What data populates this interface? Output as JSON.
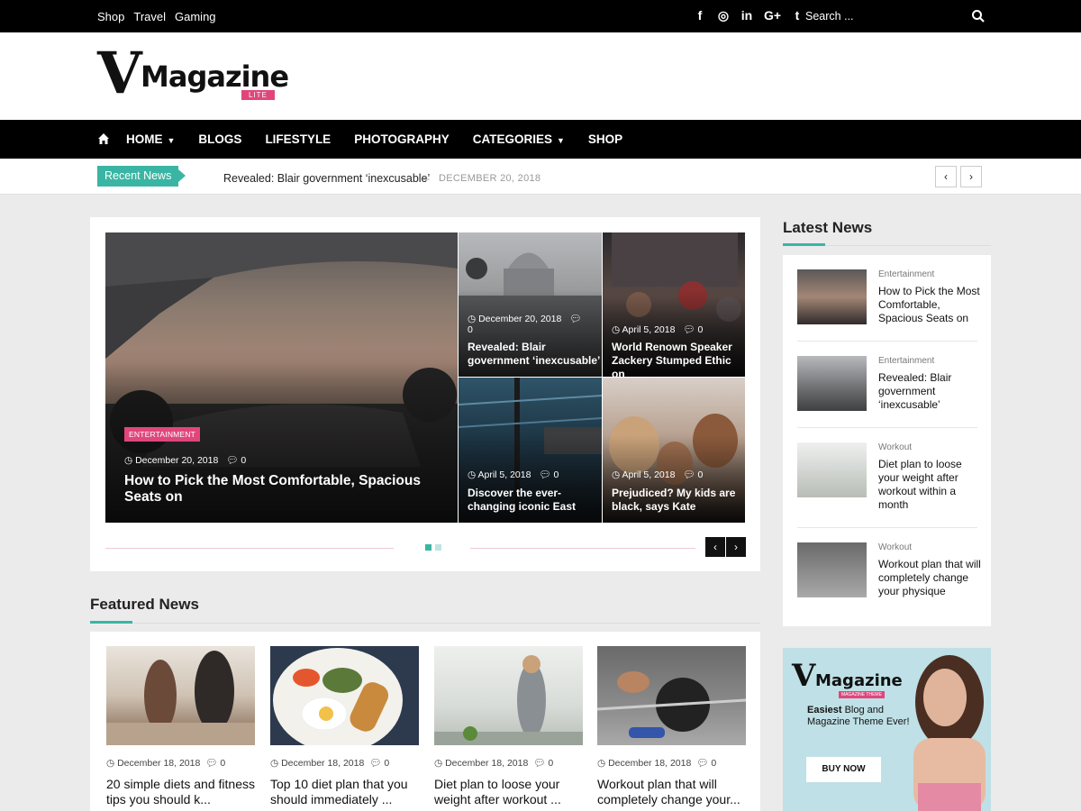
{
  "topbar": {
    "links": [
      "Shop",
      "Travel",
      "Gaming"
    ],
    "social_icons": [
      "facebook-icon",
      "instagram-icon",
      "linkedin-icon",
      "google-plus-icon",
      "tumblr-icon"
    ],
    "social_glyphs": [
      "f",
      "◎",
      "in",
      "G+",
      "t"
    ],
    "search_placeholder": "Search ..."
  },
  "logo": {
    "v": "V",
    "text": "Magazine",
    "badge": "LITE"
  },
  "nav": {
    "items": [
      {
        "label": "HOME",
        "dropdown": true
      },
      {
        "label": "BLOGS",
        "dropdown": false
      },
      {
        "label": "LIFESTYLE",
        "dropdown": false
      },
      {
        "label": "PHOTOGRAPHY",
        "dropdown": false
      },
      {
        "label": "CATEGORIES",
        "dropdown": true
      },
      {
        "label": "SHOP",
        "dropdown": false
      }
    ]
  },
  "ticker": {
    "label": "Recent News",
    "title": "Revealed: Blair government ‘inexcusable’",
    "dash": "–",
    "date": "DECEMBER 20, 2018",
    "prev": "‹",
    "next": "›"
  },
  "slider": {
    "main": {
      "category": "ENTERTAINMENT",
      "date": "December 20, 2018",
      "comments": "0",
      "title": "How to Pick the Most Comfortable, Spacious Seats on"
    },
    "tiles": [
      {
        "date": "December 20, 2018",
        "comments": "0",
        "title": "Revealed: Blair government ‘inexcusable’"
      },
      {
        "date": "April 5, 2018",
        "comments": "0",
        "title": "World Renown Speaker Zackery Stumped Ethic on"
      },
      {
        "date": "April 5, 2018",
        "comments": "0",
        "title": "Discover the ever-changing iconic East"
      },
      {
        "date": "April 5, 2018",
        "comments": "0",
        "title": "Prejudiced? My kids are black, says Kate"
      }
    ],
    "prev": "‹",
    "next": "›",
    "dot_colors": [
      "#3ab5a3",
      "#bfe5df"
    ]
  },
  "featured": {
    "title": "Featured News",
    "items": [
      {
        "date": "December 18, 2018",
        "comments": "0",
        "title": "20 simple diets and fitness tips you should k..."
      },
      {
        "date": "December 18, 2018",
        "comments": "0",
        "title": "Top 10 diet plan that you should immediately ..."
      },
      {
        "date": "December 18, 2018",
        "comments": "0",
        "title": "Diet plan to loose your weight after workout ..."
      },
      {
        "date": "December 18, 2018",
        "comments": "0",
        "title": "Workout plan that will completely change your..."
      }
    ]
  },
  "latest": {
    "title": "Latest News",
    "items": [
      {
        "category": "Entertainment",
        "title": "How to Pick the Most Comfortable, Spacious Seats on"
      },
      {
        "category": "Entertainment",
        "title": "Revealed: Blair government ‘inexcusable’"
      },
      {
        "category": "Workout",
        "title": "Diet plan to loose your weight after workout within a month"
      },
      {
        "category": "Workout",
        "title": "Workout plan that will completely change your physique"
      }
    ]
  },
  "ad": {
    "v": "V",
    "logo_text": "Magazine",
    "logo_sub": "MAGAZINE THEME",
    "tagline_bold": "Easiest",
    "tagline_rest": " Blog and",
    "tagline2": "Magazine Theme Ever!",
    "button": "BUY NOW"
  },
  "colors": {
    "accent": "#3ab5a3",
    "pink": "#e0467c",
    "dark": "#000000"
  }
}
